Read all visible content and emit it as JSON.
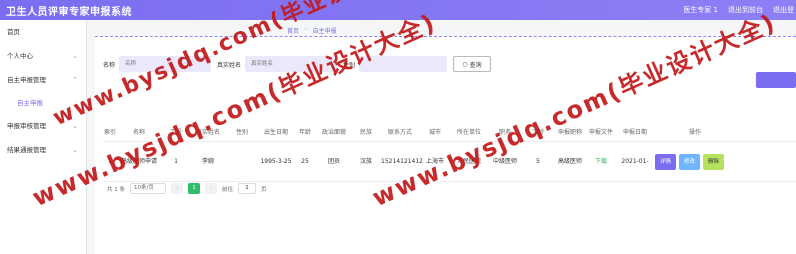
{
  "app": {
    "title": "卫生人员评审专家申报系统",
    "user_label": "医生专家 1",
    "back_label": "退出到前台",
    "logout_label": "退出登"
  },
  "sidebar": {
    "items": [
      {
        "label": "首页"
      },
      {
        "label": "个人中心"
      },
      {
        "label": "自主申报管理"
      },
      {
        "label": "自主申报"
      },
      {
        "label": "申报审核管理"
      },
      {
        "label": "结果通报管理"
      }
    ]
  },
  "breadcrumb": {
    "home": "首页",
    "current": "自主申报"
  },
  "search": {
    "name_label": "名称",
    "name_placeholder": "名称",
    "realname_label": "真实姓名",
    "realname_placeholder": "真实姓名",
    "gender_label": "性别",
    "query_label": "查询"
  },
  "table": {
    "headers": [
      "索引",
      "名称",
      "工号",
      "真实姓名",
      "性别",
      "出生日期",
      "年龄",
      "政治面貌",
      "民族",
      "联系方式",
      "城市",
      "所在单位",
      "职务",
      "工龄",
      "申报职称",
      "申报文件",
      "申报日期",
      "操作"
    ],
    "rows": [
      {
        "index": "1",
        "name": "高级医师申请",
        "job_no": "1",
        "real_name": "李婉",
        "gender": "",
        "birth": "1995-3-25",
        "age": "25",
        "political": "团员",
        "ethnic": "汉族",
        "phone": "15214121412",
        "city": "上海市",
        "unit": "人民医院",
        "duty": "中级医师",
        "years": "5",
        "title": "高级医师",
        "file": "下载",
        "date": "2021-01-",
        "op_detail": "详情",
        "op_edit": "修改",
        "op_delete": "删除"
      }
    ]
  },
  "pagination": {
    "total": "共 1 条",
    "size": "10条/页",
    "current": "1",
    "goto_label": "前往",
    "goto_value": "1",
    "page_suffix": "页"
  },
  "watermark": {
    "text": "www.bysjdq.com(毕业设计大全)",
    "left_text": "www.bysjdq.com(毕业设计大全)",
    "right_text": "www.bysjdq.com(毕业设计大全)"
  },
  "colors": {
    "accent": "#7a6df0",
    "green": "#2ebd6b",
    "watermark": "#c21818"
  }
}
